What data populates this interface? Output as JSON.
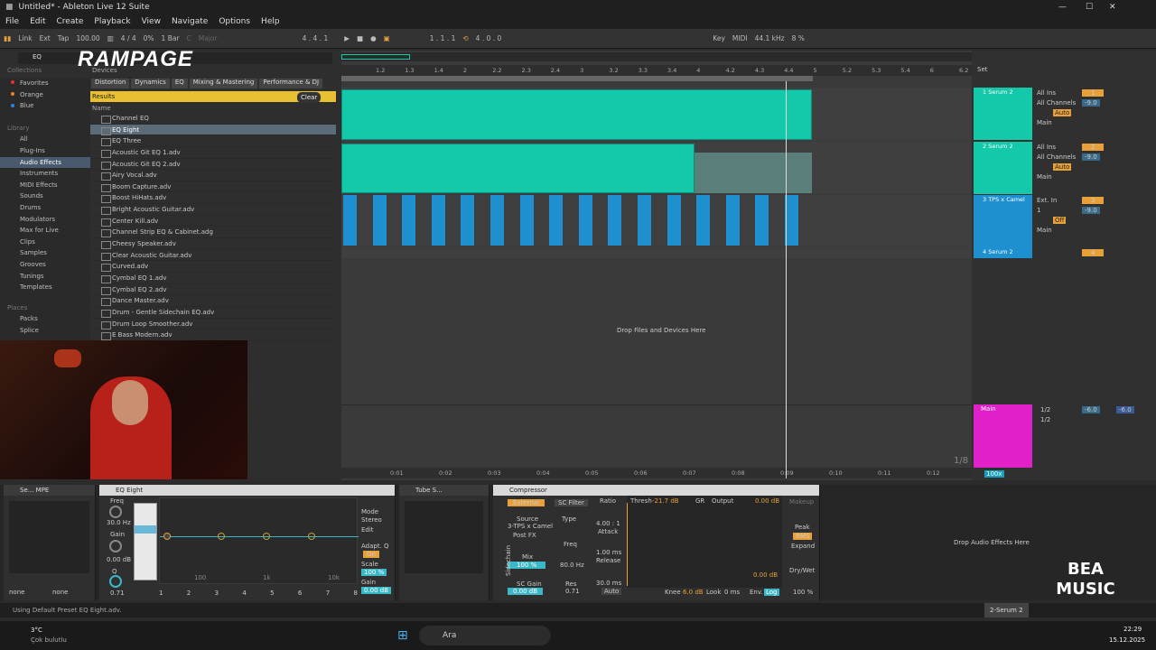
{
  "titlebar": {
    "title": "Untitled* - Ableton Live 12 Suite",
    "min": "—",
    "max": "☐",
    "close": "✕"
  },
  "menu": [
    "File",
    "Edit",
    "Create",
    "Playback",
    "View",
    "Navigate",
    "Options",
    "Help"
  ],
  "control": {
    "link": "Link",
    "ext": "Ext",
    "tap": "Tap",
    "tempo": "100.00",
    "sig": "4 / 4",
    "perc": "0%",
    "quant": "1 Bar",
    "key": "C",
    "scale": "Major",
    "pos": "4 .   4 .   1",
    "loop_start": "1 .   1 .   1",
    "loop_len": "4 .   0 .   0",
    "key_label": "Key",
    "midi": "MIDI",
    "rate": "44.1 kHz",
    "cpu": "8 %"
  },
  "browser": {
    "search": "EQ",
    "logo": "RAMPAGE",
    "devices_label": "Devices",
    "collections_label": "Collections",
    "filters": [
      "Distortion",
      "Dynamics",
      "EQ",
      "Mixing & Mastering",
      "Performance & DJ"
    ],
    "results": "Results",
    "clear": "Clear",
    "name_col": "Name",
    "collections": [
      "Favorites",
      "Orange",
      "Blue"
    ],
    "library_label": "Library",
    "library": [
      "All",
      "Plug-Ins",
      "Audio Effects",
      "Instruments",
      "MIDI Effects",
      "Sounds",
      "Drums",
      "Modulators",
      "Max for Live",
      "Clips",
      "Samples",
      "Grooves",
      "Tunings",
      "Templates"
    ],
    "places_label": "Places",
    "places": [
      "Packs",
      "Splice"
    ],
    "items": [
      "Channel EQ",
      "EQ Eight",
      "EQ Three",
      "Acoustic Git EQ 1.adv",
      "Acoustic Git EQ 2.adv",
      "Airy Vocal.adv",
      "Boom Capture.adv",
      "Boost HiHats.adv",
      "Bright Acoustic Guitar.adv",
      "Center Kill.adv",
      "Channel Strip EQ & Cabinet.adg",
      "Cheesy Speaker.adv",
      "Clear Acoustic Guitar.adv",
      "Curved.adv",
      "Cymbal EQ 1.adv",
      "Cymbal EQ 2.adv",
      "Dance Master.adv",
      "Drum - Gentle Sidechain EQ.adv",
      "Drum Loop Smoother.adv",
      "E Bass Modern.adv"
    ]
  },
  "ruler": [
    "1.2",
    "1.3",
    "1.4",
    "2",
    "2.2",
    "2.3",
    "2.4",
    "3",
    "3.2",
    "3.3",
    "3.4",
    "4",
    "4.2",
    "4.3",
    "4.4",
    "5",
    "5.2",
    "5.3",
    "5.4",
    "6",
    "6.2"
  ],
  "time_ruler": [
    "0:01",
    "0:02",
    "0:03",
    "0:04",
    "0:05",
    "0:06",
    "0:07",
    "0:08",
    "0:09",
    "0:10",
    "0:11",
    "0:12"
  ],
  "drop_files": "Drop Files and Devices Here",
  "page": "1/8",
  "set_label": "Set",
  "tracks": [
    {
      "name": "1 Serum 2",
      "in": "All Ins",
      "ch": "All Channels",
      "mon": "Auto",
      "out": "Main",
      "num": "1",
      "color": "#14c8aa",
      "vol": "-9.0"
    },
    {
      "name": "2 Serum 2",
      "in": "All Ins",
      "ch": "All Channels",
      "mon": "Auto",
      "out": "Main",
      "num": "2",
      "color": "#14c8aa",
      "vol": "-9.0"
    },
    {
      "name": "3 TPS x Camel",
      "in": "Ext. In",
      "ch": "1",
      "mon": "Off",
      "out": "Main",
      "num": "3",
      "color": "#1e90d0",
      "vol": "-9.0"
    },
    {
      "name": "4 Serum 2",
      "num": "4",
      "color": "#1e90d0"
    }
  ],
  "main_track": {
    "name": "Main",
    "io": "1/2",
    "vol": "-6.0",
    "vol2": "-6.0",
    "zoom": "100x"
  },
  "devices": {
    "serum": "Se... MPE",
    "none1": "none",
    "none2": "none",
    "eq_title": "EQ Eight",
    "freq": "Freq",
    "freq_val": "30.0 Hz",
    "gain": "Gain",
    "gain_val": "0.00 dB",
    "q": "Q",
    "q_val": "0.71",
    "mode": "Mode",
    "mode_val": "Stereo",
    "edit": "Edit",
    "adaptq": "Adapt. Q",
    "adaptq_val": "On",
    "scale": "Scale",
    "scale_val": "100 %",
    "gain2": "Gain",
    "gain2_val": "0.00 dB",
    "f100": "100",
    "f1k": "1k",
    "f10k": "10k",
    "bands": [
      "1",
      "2",
      "3",
      "4",
      "5",
      "6",
      "7",
      "8"
    ],
    "tube": "Tube S...",
    "comp_title": "Compressor",
    "external": "External",
    "sc_filter": "SC Filter",
    "source": "Source",
    "source_val": "3-TPS x Camel",
    "postfx": "Post FX",
    "type": "Type",
    "mix": "Mix",
    "mix_val": "100 %",
    "freq2": "Freq",
    "freq2_val": "80.0 Hz",
    "sc_gain": "SC Gain",
    "sc_gain_val": "0.00 dB",
    "res": "Res",
    "res_val": "0.71",
    "ratio": "Ratio",
    "ratio_val": "4.00 : 1",
    "attack": "Attack",
    "attack_val": "1.00 ms",
    "release": "Release",
    "release_val": "30.0 ms",
    "auto": "Auto",
    "thresh": "Thresh",
    "thresh_val": "-21.7 dB",
    "gr": "GR",
    "output": "Output",
    "output_val": "0.00 dB",
    "out2": "0.00 dB",
    "knee": "Knee",
    "knee_val": "6.0 dB",
    "look": "Look",
    "look_val": "0 ms",
    "env": "Env.",
    "env_val": "Log",
    "makeup": "Makeup",
    "peak": "Peak",
    "rms": "RMS",
    "expand": "Expand",
    "drywet": "Dry/Wet",
    "drywet_val": "100 %",
    "drop_fx": "Drop Audio Effects Here",
    "sidechain": "Sidechain"
  },
  "status": "Using Default Preset EQ Eight.adv.",
  "status_track": "2-Serum 2",
  "watermark": "BEA MUSIC",
  "taskbar": {
    "temp": "3°C",
    "weather": "Çok bulutlu",
    "search": "Ara",
    "time": "22:29",
    "date": "15.12.2025"
  }
}
